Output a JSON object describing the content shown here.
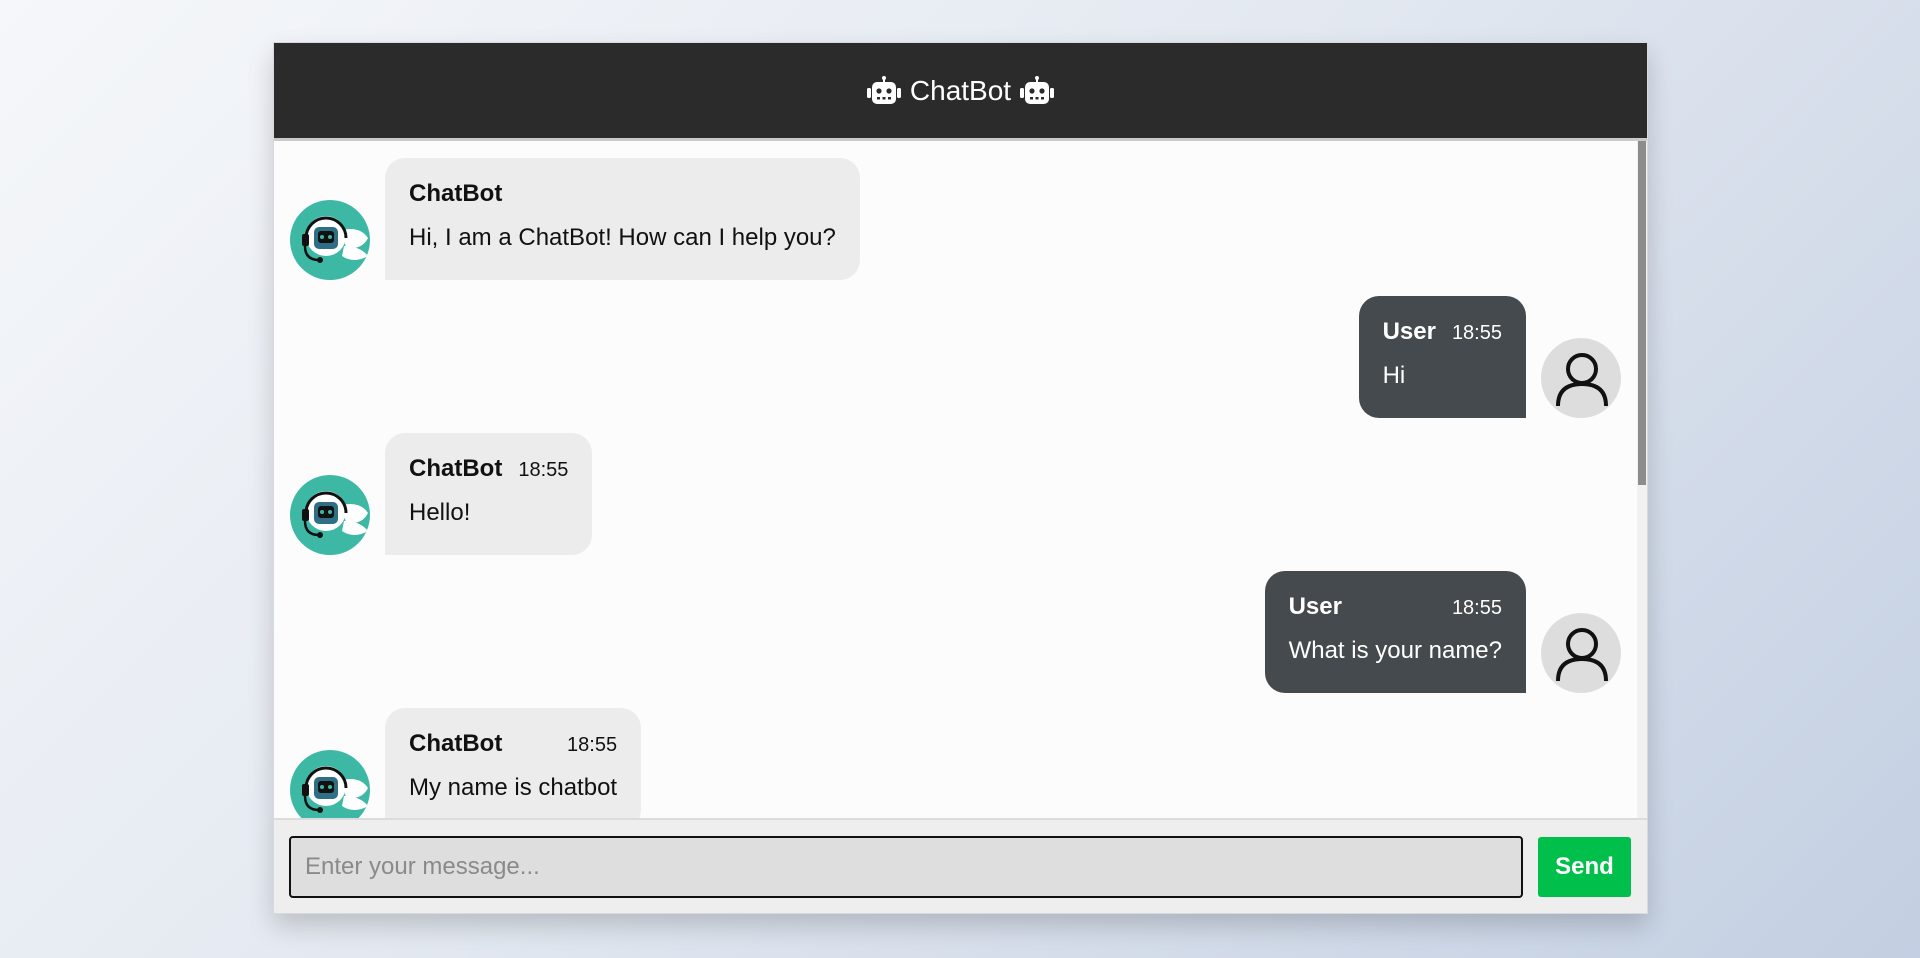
{
  "header": {
    "title": "ChatBot",
    "left_icon": "robot-icon",
    "right_icon": "robot-icon"
  },
  "messages": [
    {
      "sender": "ChatBot",
      "time": "",
      "text": "Hi, I am a ChatBot! How can I help you?",
      "side": "left"
    },
    {
      "sender": "User",
      "time": "18:55",
      "text": "Hi",
      "side": "right"
    },
    {
      "sender": "ChatBot",
      "time": "18:55",
      "text": "Hello!",
      "side": "left"
    },
    {
      "sender": "User",
      "time": "18:55",
      "text": "What is your name?",
      "side": "right"
    },
    {
      "sender": "ChatBot",
      "time": "18:55",
      "text": "My name is chatbot",
      "side": "left"
    }
  ],
  "input": {
    "placeholder": "Enter your message...",
    "value": ""
  },
  "send_button": {
    "label": "Send"
  },
  "colors": {
    "header_bg": "#2b2b2b",
    "bot_bubble": "#ececec",
    "user_bubble": "#454a4e",
    "bot_avatar": "#3db8a5",
    "send_button": "#00c04b"
  }
}
